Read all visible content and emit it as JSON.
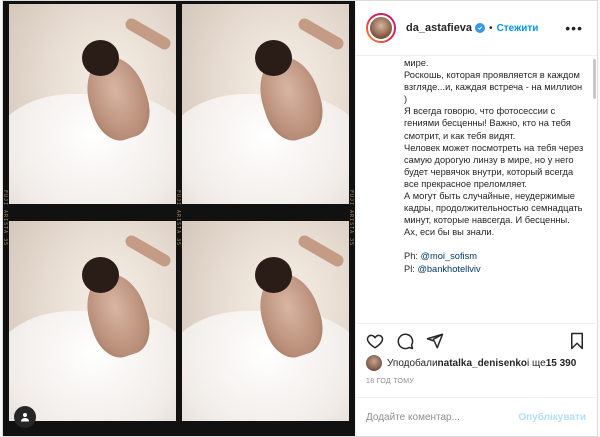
{
  "post": {
    "username": "da_astafieva",
    "follow_label": "Стежити",
    "separator": "•",
    "caption_lines": [
      "мире.",
      "Роскошь, которая проявляется в каждом взгляде...и, каждая встреча - на миллион )",
      "Я всегда говорю, что фотосессии с гениями бесценны! Важно, кто на тебя смотрит, и как тебя видят.",
      "Человек может посмотреть на тебя через самую дорогую линзу в мире, но у него будет червячок внутри, который всегда все прекрасное преломляет.",
      "А могут быть случайные, неудержимые кадры, продолжительностью семнадцать минут, которые навсегда. И бесценны.",
      "Ах, еси бы вы знали."
    ],
    "credits": [
      {
        "prefix": "Ph: ",
        "mention": "@moi_sofism"
      },
      {
        "prefix": "Pl: ",
        "mention": "@bankhotellviv"
      }
    ],
    "likes": {
      "prefix": "Уподобали ",
      "user": "natalka_denisenko",
      "middle": " і ще ",
      "count": "15 390"
    },
    "time_ago": "18 ГОД ТОМУ",
    "comment_placeholder": "Додайте коментар...",
    "publish_label": "Опублікувати",
    "film_edge_text": "FUJI ARISTA 35"
  },
  "colors": {
    "accent": "#0095f6",
    "verified": "#3897f0",
    "publish_disabled": "#b2dffc",
    "border": "#dbdbdb"
  },
  "icons": [
    "heart-icon",
    "comment-icon",
    "share-icon",
    "bookmark-icon",
    "more-icon",
    "verified-icon",
    "user-tag-icon"
  ]
}
